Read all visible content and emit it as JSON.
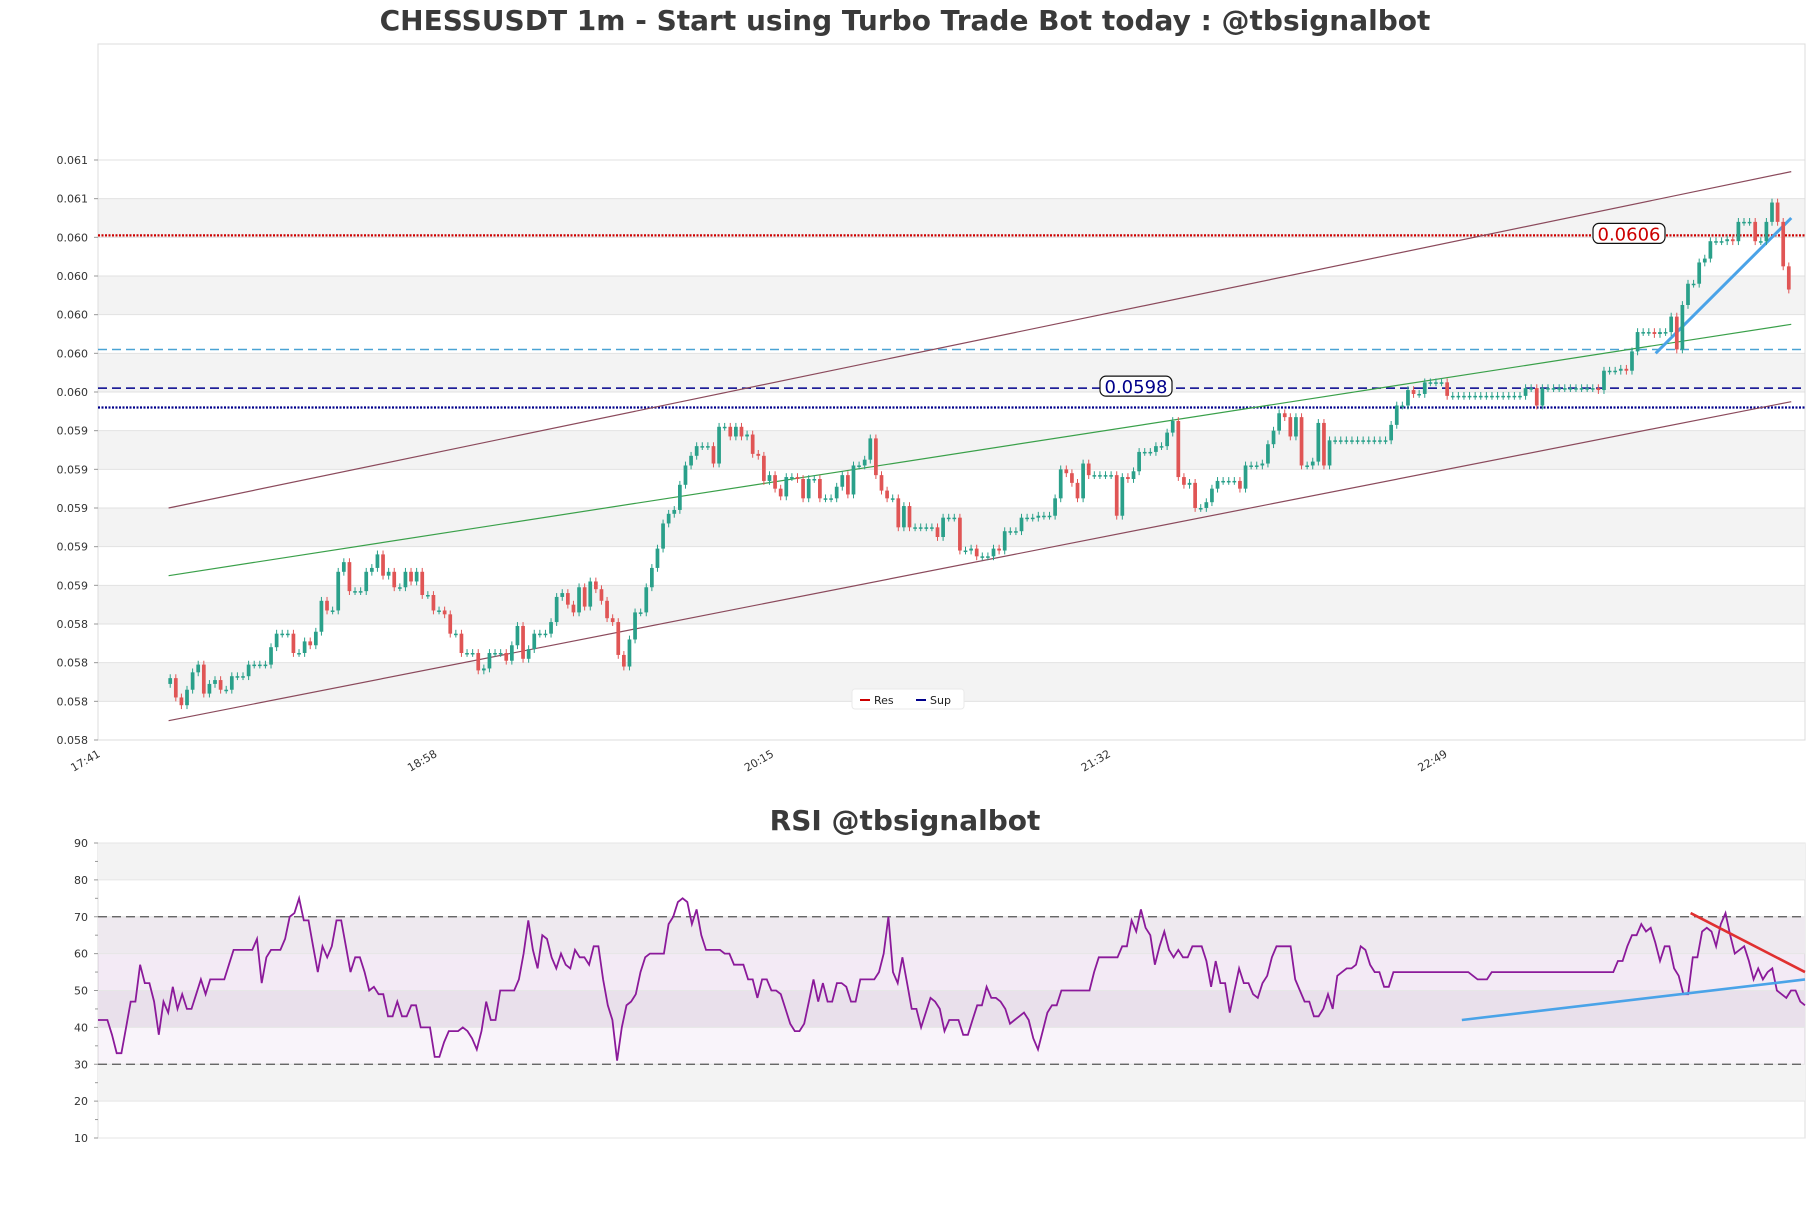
{
  "chart_data": [
    {
      "type": "candlestick",
      "title": "CHESSUSDT 1m - Start using Turbo Trade Bot today : @tbsignalbot",
      "ylim": [
        0.058,
        0.0616
      ],
      "y_tick_values": [
        0.058,
        0.0582,
        0.0584,
        0.0586,
        0.0588,
        0.059,
        0.0592,
        0.0594,
        0.0596,
        0.0598,
        0.06,
        0.0602,
        0.0604,
        0.0606,
        0.0608,
        0.061
      ],
      "y_tick_labels": [
        "0.058",
        "0.058",
        "0.058",
        "0.058",
        "0.059",
        "0.059",
        "0.059",
        "0.059",
        "0.059",
        "0.060",
        "0.060",
        "0.060",
        "0.060",
        "0.060",
        "0.061",
        "0.061"
      ],
      "x_tick_labels": [
        "17:41",
        "18:58",
        "20:15",
        "21:32",
        "22:49"
      ],
      "x_range": [
        0,
        388
      ],
      "x_tick_values": [
        0,
        77,
        154,
        231,
        308
      ],
      "legend": {
        "placement": "bottom-center",
        "entries": [
          {
            "label": "Res",
            "color": "#cc0000"
          },
          {
            "label": "Sup",
            "color": "#00008b"
          }
        ]
      },
      "levels": [
        {
          "name": "Res",
          "value": 0.06061,
          "label": "0.0606",
          "color": "#cc0000",
          "style": "dotted"
        },
        {
          "name": "Sup",
          "value": 0.05972,
          "label": "",
          "color": "#00008b",
          "style": "dotted"
        },
        {
          "name": "sup-dashed",
          "value": 0.05982,
          "label": "0.0598",
          "color": "#00008b",
          "style": "dashed"
        },
        {
          "name": "res-dashed",
          "value": 0.06002,
          "label": "",
          "color": "#4aa3d4",
          "style": "dashed"
        }
      ],
      "channel": {
        "upper": {
          "from": [
            15,
            0.0592
          ],
          "to": [
            386,
            0.06094
          ]
        },
        "middle": {
          "from": [
            15,
            0.05885
          ],
          "to": [
            386,
            0.06015
          ]
        },
        "lower": {
          "from": [
            15,
            0.0581
          ],
          "to": [
            386,
            0.05975
          ]
        }
      },
      "trend_line": {
        "from": [
          355,
          0.06
        ],
        "to": [
          386,
          0.0607
        ]
      },
      "candles": {
        "open": [
          0.05829,
          0.05832,
          0.05822,
          0.05818,
          0.05826,
          0.05835,
          0.05839,
          0.05824,
          0.05829,
          0.05831,
          0.05826,
          0.05826,
          0.05833,
          0.05833,
          0.05833,
          0.05839,
          0.05839,
          0.05839,
          0.05839,
          0.05848,
          0.05855,
          0.05855,
          0.05855,
          0.05845,
          0.05845,
          0.05851,
          0.05849,
          0.05856,
          0.05872,
          0.05867,
          0.05867,
          0.05887,
          0.05892,
          0.05877,
          0.05877,
          0.05877,
          0.05887,
          0.05889,
          0.05896,
          0.05885,
          0.05887,
          0.05879,
          0.05879,
          0.05887,
          0.05882,
          0.05887,
          0.05875,
          0.05875,
          0.05867,
          0.05867,
          0.05865,
          0.05855,
          0.05855,
          0.05845,
          0.05845,
          0.05845,
          0.05836,
          0.05837,
          0.05845,
          0.05845,
          0.05845,
          0.05841,
          0.05849,
          0.05859,
          0.05842,
          0.05847,
          0.05855,
          0.05855,
          0.05855,
          0.05861,
          0.05874,
          0.05876,
          0.0587,
          0.05866,
          0.05879,
          0.05869,
          0.05882,
          0.05878,
          0.05872,
          0.05863,
          0.05861,
          0.05844,
          0.05838,
          0.05852,
          0.05866,
          0.05866,
          0.05879,
          0.05889,
          0.05899,
          0.05912,
          0.05917,
          0.05919,
          0.05932,
          0.05942,
          0.05947,
          0.05952,
          0.05952,
          0.05952,
          0.05943,
          0.05962,
          0.05962,
          0.05957,
          0.05962,
          0.05957,
          0.05958,
          0.05948,
          0.05947,
          0.05934,
          0.05937,
          0.0593,
          0.05926,
          0.05936,
          0.05936,
          0.05935,
          0.05925,
          0.05935,
          0.05935,
          0.05925,
          0.05925,
          0.05925,
          0.05931,
          0.05937,
          0.05927,
          0.05942,
          0.05942,
          0.05945,
          0.05956,
          0.05937,
          0.05929,
          0.05925,
          0.05925,
          0.0591,
          0.05921,
          0.0591,
          0.0591,
          0.0591,
          0.0591,
          0.0591,
          0.05905,
          0.05915,
          0.05915,
          0.05915,
          0.05898,
          0.05898,
          0.05899,
          0.05895,
          0.05895,
          0.05895,
          0.05899,
          0.05898,
          0.05908,
          0.05908,
          0.05908,
          0.05915,
          0.05915,
          0.05915,
          0.05916,
          0.05916,
          0.05916,
          0.05925,
          0.0594,
          0.05938,
          0.05933,
          0.05925,
          0.05943,
          0.05937,
          0.05937,
          0.05937,
          0.05937,
          0.05937,
          0.05916,
          0.05936,
          0.05935,
          0.05939,
          0.05949,
          0.05949,
          0.05949,
          0.05952,
          0.05952,
          0.05959,
          0.05965,
          0.05936,
          0.05932,
          0.05933,
          0.0592,
          0.0592,
          0.05923,
          0.0593,
          0.05934,
          0.05934,
          0.05934,
          0.05934,
          0.0593,
          0.05942,
          0.05942,
          0.05942,
          0.05943,
          0.05953,
          0.0596,
          0.05969,
          0.05967,
          0.05957,
          0.05967,
          0.05942,
          0.05942,
          0.05944,
          0.05964,
          0.05942,
          0.05955,
          0.05955,
          0.05955,
          0.05955,
          0.05955,
          0.05955,
          0.05955,
          0.05955,
          0.05955,
          0.05955,
          0.05955,
          0.05963,
          0.05973,
          0.05973,
          0.05981,
          0.05979,
          0.05979,
          0.05985,
          0.05985,
          0.05985,
          0.05985,
          0.05978,
          0.05978,
          0.05978,
          0.05978,
          0.05978,
          0.05978,
          0.05978,
          0.05978,
          0.05978,
          0.05978,
          0.05978,
          0.05978,
          0.05978,
          0.05978,
          0.05982,
          0.05982,
          0.05973,
          0.05982,
          0.05982,
          0.05982,
          0.05982,
          0.05982,
          0.05982,
          0.05982,
          0.05982,
          0.05982,
          0.05982,
          0.05981,
          0.05991,
          0.05991,
          0.05991,
          0.05992,
          0.05991,
          0.06001,
          0.06011,
          0.06011,
          0.06011,
          0.0601,
          0.06011,
          0.06011,
          0.06019,
          0.06002,
          0.06025,
          0.06036,
          0.06036,
          0.06047,
          0.06049,
          0.06058,
          0.06058,
          0.06058,
          0.06059,
          0.06058,
          0.06068,
          0.06068,
          0.06068,
          0.06058,
          0.06058,
          0.06068,
          0.06078,
          0.06068,
          0.06045,
          0.06033
        ]
      }
    },
    {
      "type": "line",
      "title": "RSI @tbsignalbot",
      "ylim": [
        10,
        90
      ],
      "y_tick_labels": [
        "10",
        "20",
        "30",
        "40",
        "50",
        "60",
        "70",
        "80",
        "90"
      ],
      "y_tick_values": [
        10,
        20,
        30,
        40,
        50,
        60,
        70,
        80,
        90
      ],
      "x_range": [
        0,
        388
      ],
      "reference_lines": [
        70,
        30
      ],
      "bands": [
        [
          40,
          60
        ],
        [
          30,
          70
        ]
      ],
      "series": [
        {
          "color": "#8b1a9a"
        }
      ],
      "values": [
        42,
        42,
        42,
        38,
        33,
        33,
        40,
        47,
        47,
        57,
        52,
        52,
        47,
        38,
        47,
        44,
        51,
        45,
        49,
        45,
        45,
        49,
        53,
        49,
        53,
        53,
        53,
        53,
        57,
        61,
        61,
        61,
        61,
        61,
        64,
        52,
        59,
        61,
        61,
        61,
        64,
        70,
        71,
        75,
        69,
        69,
        62,
        55,
        62,
        59,
        62,
        69,
        69,
        62,
        55,
        59,
        59,
        55,
        50,
        51,
        49,
        49,
        43,
        43,
        47,
        43,
        43,
        46,
        46,
        40,
        40,
        40,
        32,
        32,
        36,
        39,
        39,
        39,
        40,
        39,
        37,
        34,
        39,
        47,
        42,
        42,
        50,
        50,
        50,
        50,
        53,
        60,
        69,
        61,
        56,
        65,
        64,
        59,
        56,
        60,
        57,
        56,
        61,
        59,
        59,
        57,
        62,
        62,
        53,
        46,
        42,
        31,
        40,
        46,
        47,
        49,
        55,
        59,
        60,
        60,
        60,
        60,
        68,
        70,
        74,
        75,
        74,
        68,
        72,
        65,
        61,
        61,
        61,
        61,
        60,
        60,
        57,
        57,
        57,
        53,
        53,
        48,
        53,
        53,
        50,
        50,
        49,
        45,
        41,
        39,
        39,
        41,
        47,
        53,
        47,
        52,
        47,
        47,
        52,
        52,
        51,
        47,
        47,
        53,
        53,
        53,
        53,
        55,
        60,
        70,
        55,
        52,
        59,
        52,
        45,
        45,
        40,
        44,
        48,
        47,
        45,
        39,
        42,
        42,
        42,
        38,
        38,
        42,
        46,
        46,
        51,
        48,
        48,
        47,
        45,
        41,
        42,
        43,
        44,
        42,
        37,
        34,
        39,
        44,
        46,
        46,
        50,
        50,
        50,
        50,
        50,
        50,
        50,
        55,
        59,
        59,
        59,
        59,
        59,
        62,
        62,
        69,
        66,
        72,
        67,
        65,
        57,
        62,
        66,
        61,
        59,
        61,
        59,
        59,
        62,
        62,
        62,
        58,
        51,
        58,
        52,
        52,
        44,
        50,
        56,
        52,
        52,
        49,
        48,
        52,
        54,
        59,
        62,
        62,
        62,
        62,
        53,
        50,
        47,
        47,
        43,
        43,
        45,
        49,
        45,
        54,
        55,
        56,
        56,
        57,
        62,
        61,
        57,
        55,
        55,
        51,
        51,
        55,
        55,
        55,
        55,
        55,
        55,
        55,
        55,
        55,
        55,
        55,
        55,
        55,
        55,
        55,
        55,
        55,
        54,
        53,
        53,
        53,
        55,
        55,
        55,
        55,
        55,
        55,
        55,
        55,
        55,
        55,
        55,
        55,
        55,
        55,
        55,
        55,
        55,
        55,
        55,
        55,
        55,
        55,
        55,
        55,
        55,
        55,
        55,
        58,
        58,
        62,
        65,
        65,
        68,
        66,
        67,
        63,
        58,
        62,
        62,
        56,
        54,
        49,
        49,
        59,
        59,
        66,
        67,
        66,
        62,
        68,
        71,
        65,
        60,
        61,
        62,
        58,
        53,
        56,
        53,
        55,
        56,
        50,
        49,
        48,
        50,
        50,
        47,
        46
      ],
      "trend_lines": [
        {
          "color": "#4aa3e8",
          "from": [
            310,
            42
          ],
          "to": [
            388,
            53
          ]
        },
        {
          "color": "#e03030",
          "from": [
            362,
            71
          ],
          "to": [
            388,
            55
          ]
        }
      ]
    }
  ]
}
